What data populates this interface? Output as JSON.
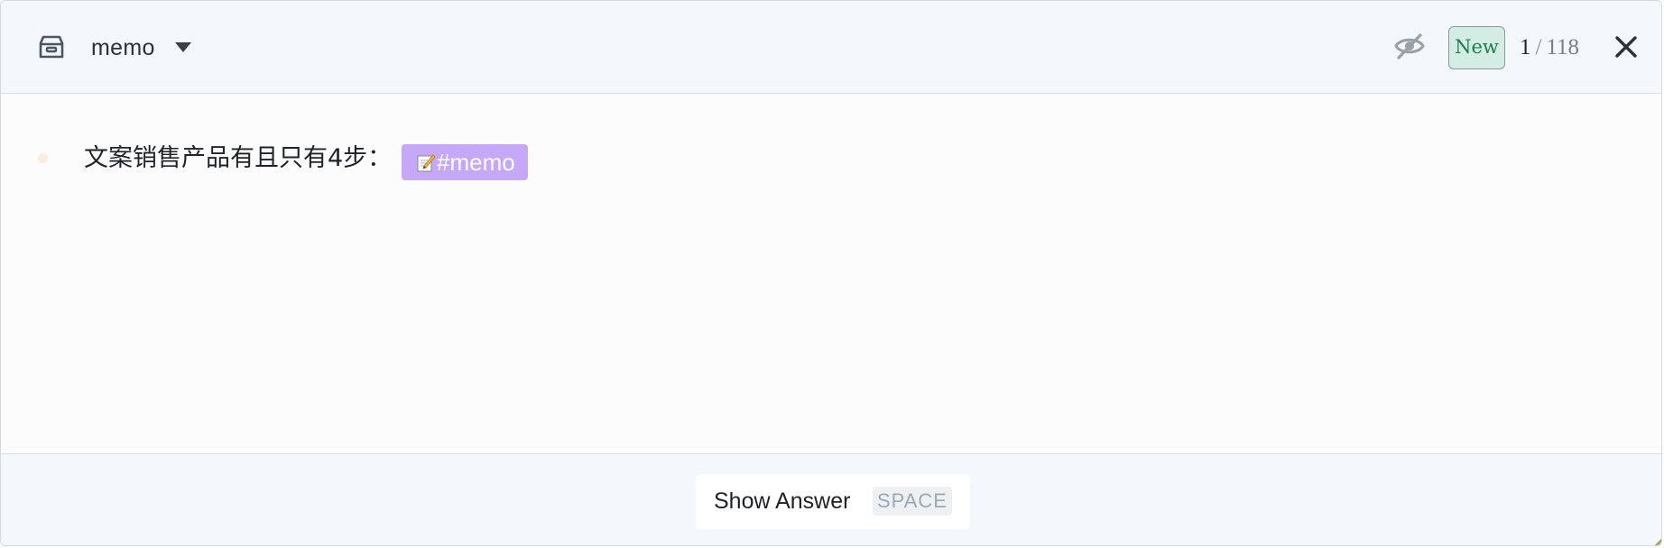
{
  "header": {
    "deck_name": "memo",
    "badge": "New",
    "counter": {
      "current": "1",
      "separator": "/",
      "total": "118"
    },
    "icons": {
      "deck": "archive-box-icon",
      "deck_dropdown": "caret-down-icon",
      "visibility": "eye-off-icon",
      "close": "close-icon"
    }
  },
  "card": {
    "text": "文案销售产品有且只有4步：",
    "tag": {
      "label": "#memo",
      "icon": "memo-icon",
      "color": "#c5a8f8"
    }
  },
  "footer": {
    "show_answer_label": "Show Answer",
    "shortcut": "SPACE"
  },
  "colors": {
    "header_bg": "#f4f8fc",
    "content_bg": "#fcfcfc",
    "badge_bg": "#d3ede4",
    "badge_text": "#1b8048"
  }
}
